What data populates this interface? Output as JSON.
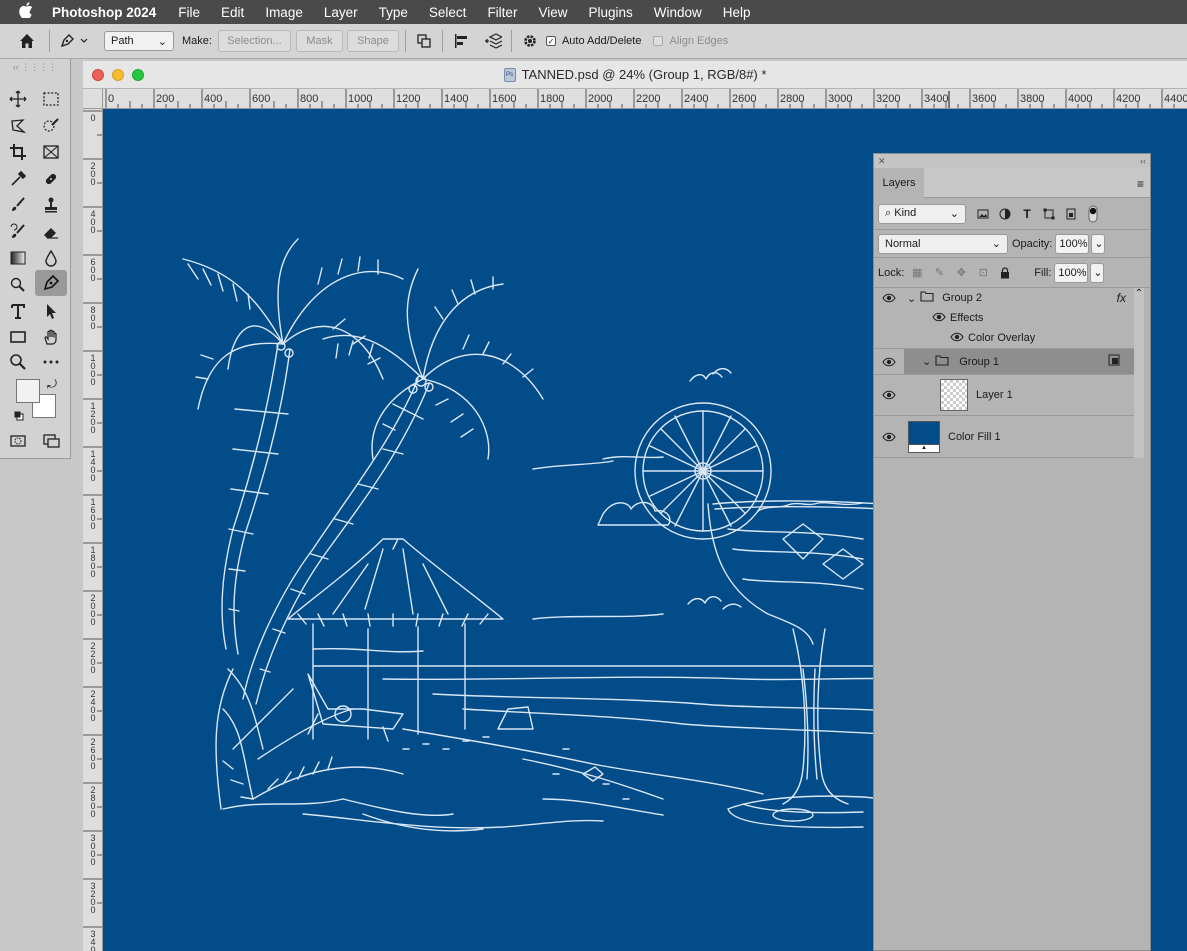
{
  "menubar": {
    "app_name": "Photoshop 2024",
    "items": [
      "File",
      "Edit",
      "Image",
      "Layer",
      "Type",
      "Select",
      "Filter",
      "View",
      "Plugins",
      "Window",
      "Help"
    ]
  },
  "options_bar": {
    "mode_select": "Path",
    "make_label": "Make:",
    "selection_btn": "Selection...",
    "mask_btn": "Mask",
    "shape_btn": "Shape",
    "auto_add_delete": "Auto Add/Delete",
    "align_edges": "Align Edges"
  },
  "document": {
    "title": "TANNED.psd @ 24% (Group 1, RGB/8#) *",
    "canvas_color": "#024c8a"
  },
  "ruler": {
    "h_labels": [
      "0",
      "200",
      "400",
      "600",
      "800",
      "1000",
      "1200",
      "1400",
      "1600",
      "1800",
      "2000",
      "2200",
      "2400",
      "2600",
      "2800",
      "3000",
      "3200",
      "3400",
      "3600",
      "3800",
      "4000",
      "4200",
      "4400"
    ],
    "v_labels": [
      "0",
      "2\n0\n0",
      "4\n0\n0",
      "6\n0\n0",
      "8\n0\n0",
      "1\n0\n0\n0",
      "1\n2\n0\n0",
      "1\n4\n0\n0",
      "1\n6\n0\n0",
      "1\n8\n0\n0",
      "2\n0\n0\n0",
      "2\n2\n0\n0",
      "2\n4\n0\n0",
      "2\n6\n0\n0",
      "2\n8\n0\n0",
      "3\n0\n0\n0",
      "3\n2\n0\n0",
      "3\n4\n0\n0"
    ]
  },
  "layers_panel": {
    "tab": "Layers",
    "filter_kind": "Kind",
    "blend_mode": "Normal",
    "opacity_label": "Opacity:",
    "opacity_value": "100%",
    "lock_label": "Lock:",
    "fill_label": "Fill:",
    "fill_value": "100%",
    "layers": {
      "group2": "Group 2",
      "effects": "Effects",
      "color_overlay": "Color Overlay",
      "group1": "Group 1",
      "layer1": "Layer 1",
      "color_fill": "Color Fill 1"
    },
    "fx_label": "fx",
    "fill_swatch_color": "#024c8a"
  }
}
